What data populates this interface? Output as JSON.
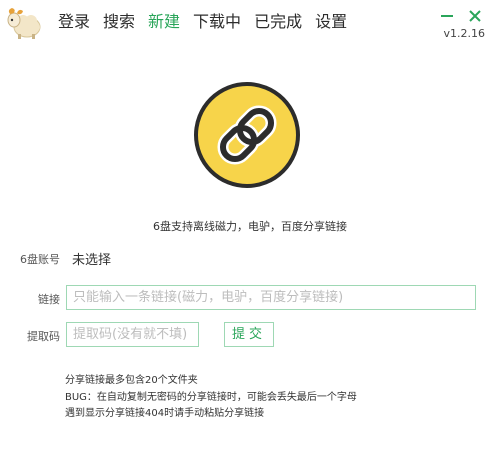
{
  "nav": {
    "items": [
      {
        "label": "登录",
        "active": false
      },
      {
        "label": "搜索",
        "active": false
      },
      {
        "label": "新建",
        "active": true
      },
      {
        "label": "下载中",
        "active": false
      },
      {
        "label": "已完成",
        "active": false
      },
      {
        "label": "设置",
        "active": false
      }
    ]
  },
  "window": {
    "version": "v1.2.16",
    "minimize_icon": "minimize-icon",
    "close_icon": "close-icon"
  },
  "colors": {
    "accent": "#2aa55a",
    "hero_fill": "#f7d44a",
    "input_border": "#9ed8b4"
  },
  "hero": {
    "icon": "link-icon",
    "subtitle": "6盘支持离线磁力，电驴，百度分享链接"
  },
  "form": {
    "account_label": "6盘账号",
    "account_value": "未选择",
    "link_label": "链接",
    "link_placeholder": "只能输入一条链接(磁力，电驴，百度分享链接)",
    "code_label": "提取码",
    "code_placeholder": "提取码(没有就不填)",
    "submit_label": "提交"
  },
  "notes": [
    "分享链接最多包含20个文件夹",
    "BUG：在自动复制无密码的分享链接时，可能会丢失最后一个字母",
    "遇到显示分享链接404时请手动粘贴分享链接"
  ]
}
